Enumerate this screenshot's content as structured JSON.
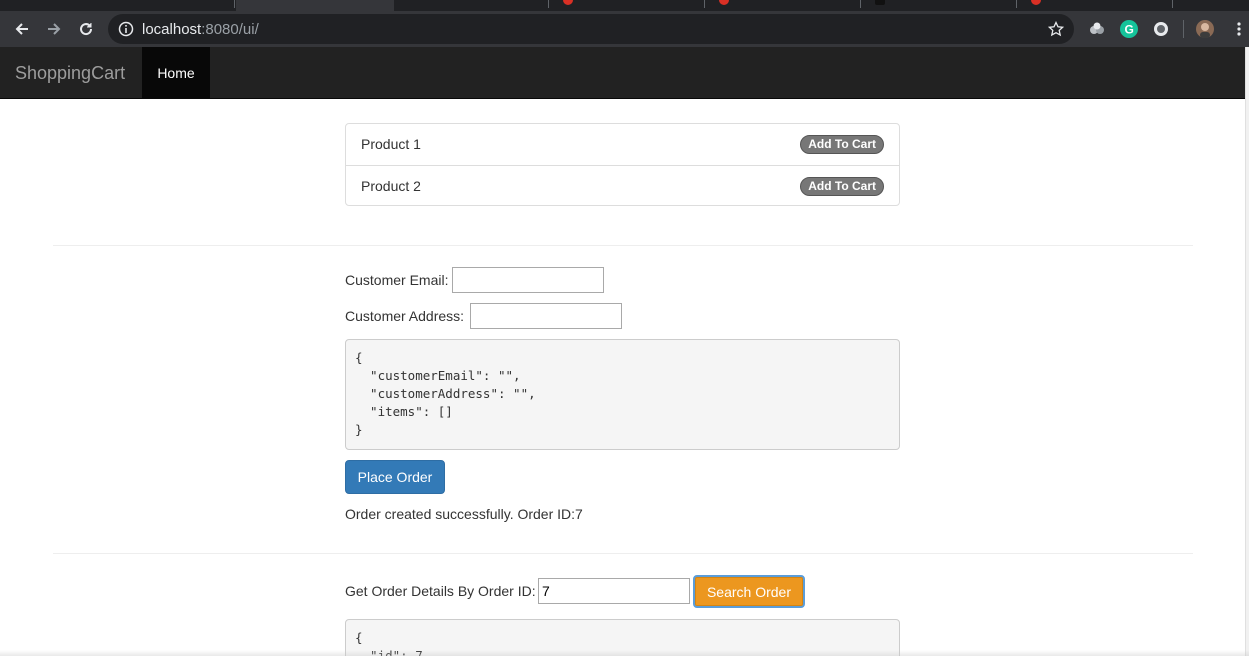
{
  "browser": {
    "url_host": "localhost",
    "url_path": ":8080/ui/",
    "icons": [
      "back-icon",
      "forward-icon",
      "reload-icon",
      "info-icon",
      "star-icon",
      "extension-icon",
      "grammarly-icon",
      "record-icon",
      "profile-avatar",
      "menu-icon"
    ]
  },
  "navbar": {
    "brand": "ShoppingCart",
    "home": "Home"
  },
  "products": [
    {
      "name": "Product 1",
      "action": "Add To Cart"
    },
    {
      "name": "Product 2",
      "action": "Add To Cart"
    }
  ],
  "order_form": {
    "email_label": "Customer Email:",
    "email_value": "",
    "address_label": "Customer Address:",
    "address_value": "",
    "payload": "{\n  \"customerEmail\": \"\",\n  \"customerAddress\": \"\",\n  \"items\": []\n}",
    "submit": "Place Order",
    "status": "Order created successfully. Order ID:7"
  },
  "order_search": {
    "label": "Get Order Details By Order ID:",
    "value": "7",
    "submit": "Search Order",
    "result": "{\n  \"id\": 7,"
  },
  "colors": {
    "primary": "#337ab7",
    "warning": "#ec971f",
    "navbar": "#222222",
    "badge": "#777777"
  }
}
